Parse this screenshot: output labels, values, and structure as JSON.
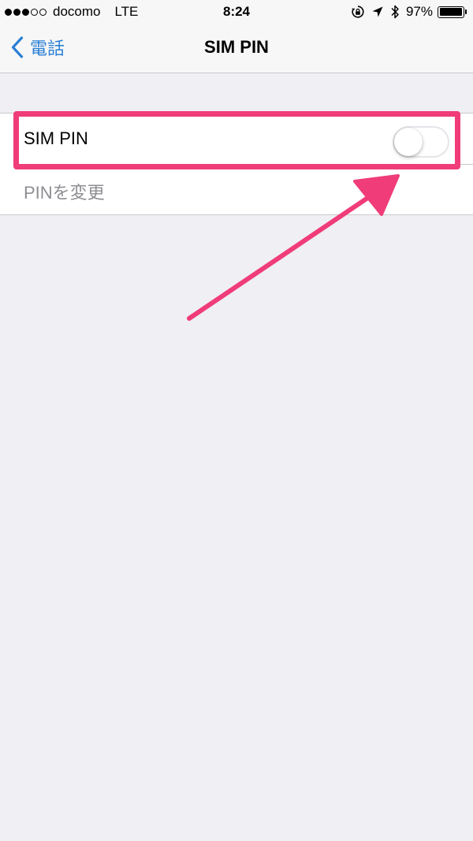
{
  "status_bar": {
    "signal_filled": 3,
    "signal_empty": 2,
    "carrier": "docomo",
    "network": "LTE",
    "time": "8:24",
    "icons": [
      "rotation-lock-icon",
      "location-arrow-icon",
      "bluetooth-icon"
    ],
    "battery_percent": "97%",
    "battery_level": 0.97
  },
  "nav": {
    "back_label": "電話",
    "title": "SIM PIN"
  },
  "settings": {
    "sim_pin": {
      "label": "SIM PIN",
      "enabled": false
    },
    "change_pin": {
      "label": "PINを変更",
      "disabled": true
    }
  },
  "annotation": {
    "color": "#f03c78"
  },
  "colors": {
    "accent": "#2b7fd6",
    "background": "#efeff4",
    "separator": "#c8c7cc",
    "disabled_text": "#8e8e93"
  }
}
